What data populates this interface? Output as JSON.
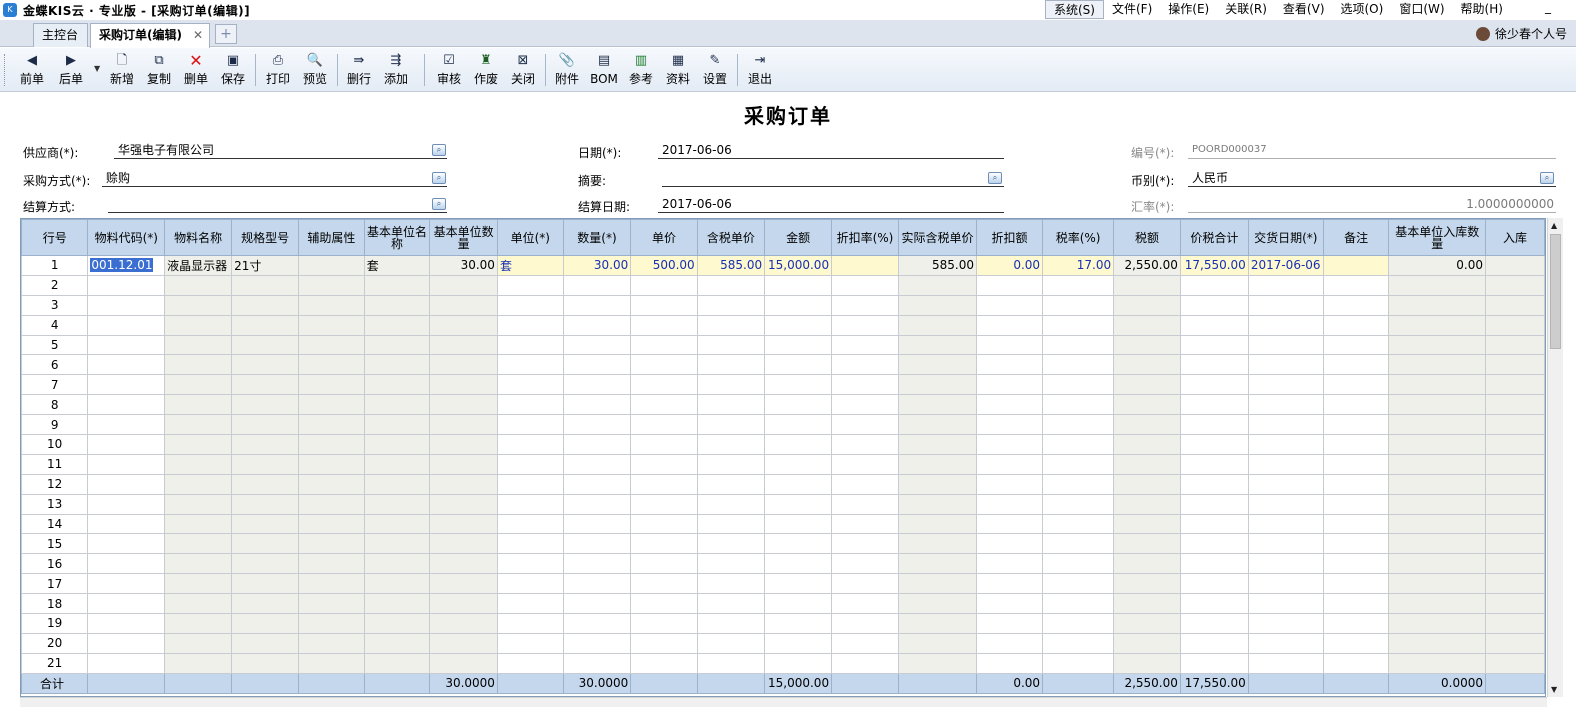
{
  "titlebar": {
    "icon_text": "K",
    "title": "金蝶KIS云 · 专业版 - [采购订单(编辑)]"
  },
  "menu": [
    "系统(S)",
    "文件(F)",
    "操作(E)",
    "关联(R)",
    "查看(V)",
    "选项(O)",
    "窗口(W)",
    "帮助(H)"
  ],
  "minimize": "_",
  "tabs": {
    "home": "主控台",
    "active": "采购订单(编辑)",
    "close": "✕",
    "add": "+"
  },
  "user": {
    "name": "徐少春个人号"
  },
  "toolbar": {
    "prev": "前单",
    "next": "后单",
    "new": "新增",
    "copy": "复制",
    "delete": "删单",
    "save": "保存",
    "print": "打印",
    "preview": "预览",
    "delrow": "删行",
    "addrow": "添加",
    "audit": "审核",
    "void": "作废",
    "close": "关闭",
    "attach": "附件",
    "bom": "BOM",
    "ref": "参考",
    "data": "资料",
    "settings": "设置",
    "exit": "退出"
  },
  "form": {
    "title": "采购订单",
    "supplier_label": "供应商(*):",
    "supplier": "华强电子有限公司",
    "date_label": "日期(*):",
    "date": "2017-06-06",
    "number_label": "编号(*):",
    "number": "POORD000037",
    "purchase_method_label": "采购方式(*):",
    "purchase_method": "赊购",
    "summary_label": "摘要:",
    "summary": "",
    "currency_label": "币别(*):",
    "currency": "人民币",
    "settle_method_label": "结算方式:",
    "settle_method": "",
    "settle_date_label": "结算日期:",
    "settle_date": "2017-06-06",
    "rate_label": "汇率(*):",
    "rate": "1.0000000000"
  },
  "grid": {
    "columns": [
      "行号",
      "物料代码(*)",
      "物料名称",
      "规格型号",
      "辅助属性",
      "基本单位名称",
      "基本单位数量",
      "单位(*)",
      "数量(*)",
      "单价",
      "含税单价",
      "金额",
      "折扣率(%)",
      "实际含税单价",
      "折扣额",
      "税率(%)",
      "税额",
      "价税合计",
      "交货日期(*)",
      "备注",
      "基本单位入库数量",
      "入库"
    ],
    "row1": {
      "no": "1",
      "code": "001.12.01",
      "name": "液晶显示器",
      "spec": "21寸",
      "aux": "",
      "base_unit": "套",
      "base_qty": "30.00",
      "unit": "套",
      "qty": "30.00",
      "price": "500.00",
      "tax_price": "585.00",
      "amount": "15,000.00",
      "discount_rate": "",
      "actual_tax_price": "585.00",
      "discount_amt": "0.00",
      "tax_rate": "17.00",
      "tax": "2,550.00",
      "total": "17,550.00",
      "delivery_date": "2017-06-06",
      "remark": "",
      "base_in_qty": "0.00",
      "in": ""
    },
    "empty_rows": [
      "2",
      "3",
      "4",
      "5",
      "6",
      "7",
      "8",
      "9",
      "10",
      "11",
      "12",
      "13",
      "14",
      "15",
      "16",
      "17",
      "18",
      "19",
      "20",
      "21"
    ],
    "totals": {
      "label": "合计",
      "base_qty": "30.0000",
      "qty": "30.0000",
      "amount": "15,000.00",
      "discount_amt": "0.00",
      "tax": "2,550.00",
      "total": "17,550.00",
      "base_in_qty": "0.0000"
    }
  },
  "scroll": {
    "up": "▲",
    "down": "▼"
  }
}
